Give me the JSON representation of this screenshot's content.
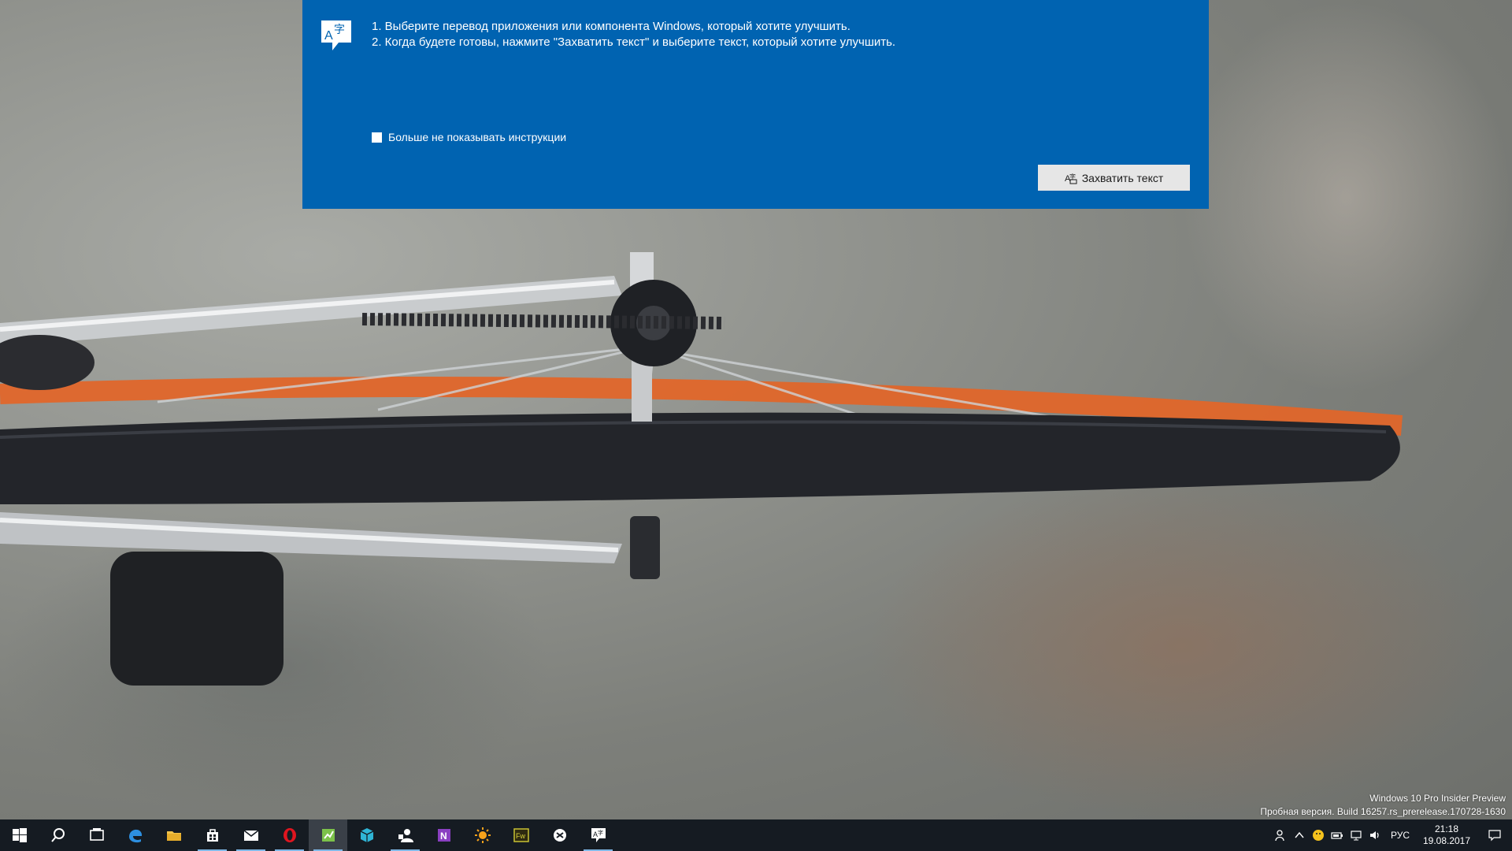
{
  "panel": {
    "instruction_1": "1. Выберите перевод приложения или компонента Windows, который хотите улучшить.",
    "instruction_2": "2. Когда будете готовы, нажмите \"Захватить текст\" и выберите текст, который хотите улучшить.",
    "checkbox_label": "Больше не показывать инструкции",
    "checkbox_checked": false,
    "capture_button_label": "Захватить текст",
    "icon": "translate-icon",
    "background_color": "#0063b1"
  },
  "watermark": {
    "line_1": "Windows 10 Pro Insider Preview",
    "line_2": "Пробная версия. Build 16257.rs_prerelease.170728-1630"
  },
  "taskbar": {
    "apps": [
      {
        "icon": "windows-start-icon"
      },
      {
        "icon": "search-icon"
      },
      {
        "icon": "task-view-icon"
      },
      {
        "icon": "edge-icon"
      },
      {
        "icon": "file-explorer-icon"
      },
      {
        "icon": "store-icon"
      },
      {
        "icon": "mail-icon"
      },
      {
        "icon": "opera-icon"
      },
      {
        "icon": "spreadsheet-app-icon"
      },
      {
        "icon": "cube-app-icon"
      },
      {
        "icon": "people-app-icon"
      },
      {
        "icon": "onenote-icon"
      },
      {
        "icon": "sun-app-icon"
      },
      {
        "icon": "fireworks-icon"
      },
      {
        "icon": "snip-app-icon"
      },
      {
        "icon": "translator-app-icon"
      }
    ],
    "tray": {
      "language": "РУС",
      "time": "21:18",
      "date": "19.08.2017"
    }
  }
}
